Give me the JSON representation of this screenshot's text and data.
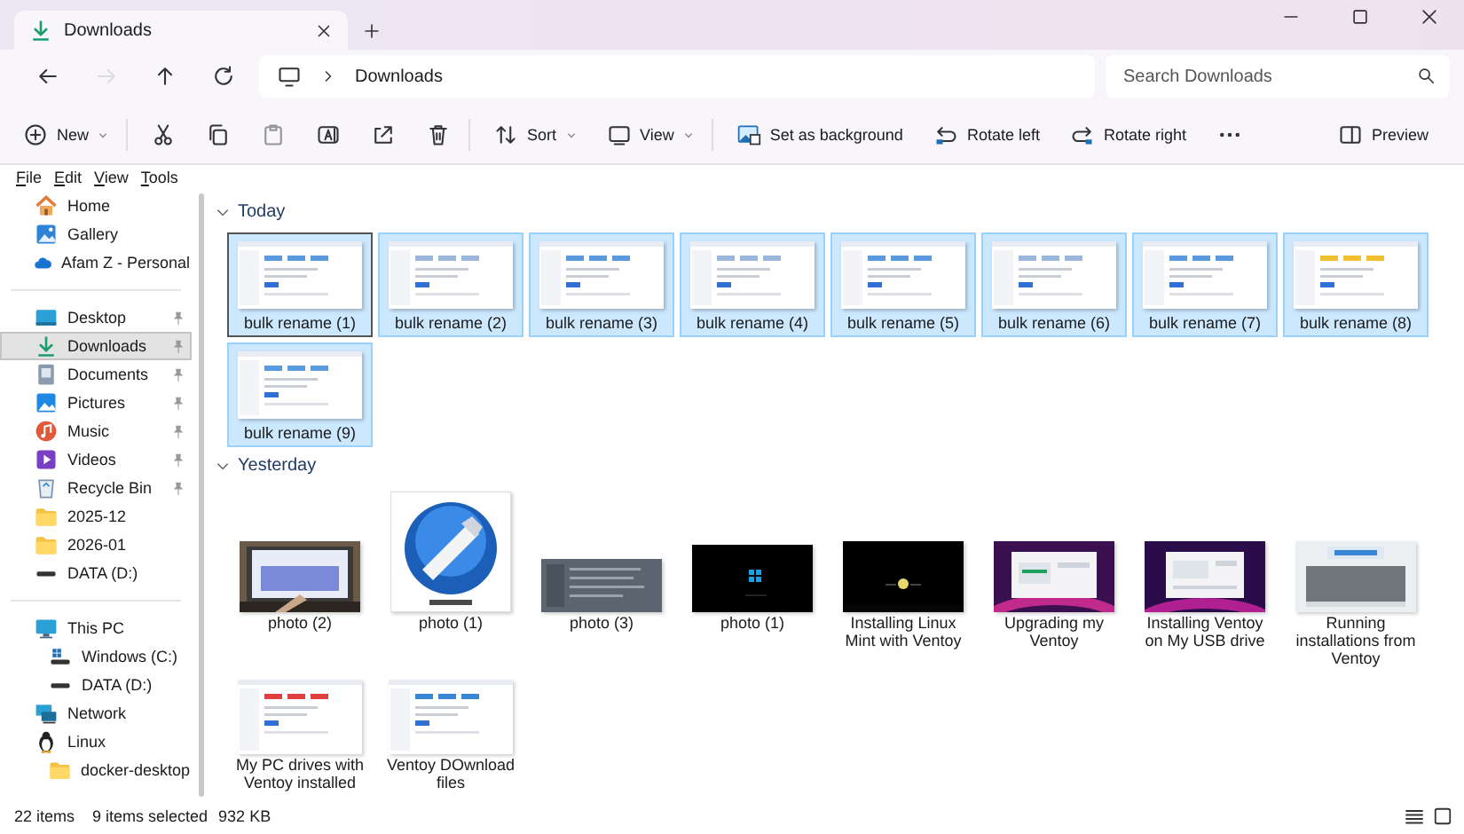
{
  "window": {
    "tab_title": "Downloads"
  },
  "address": {
    "path": "Downloads",
    "search_placeholder": "Search Downloads",
    "forward_disabled": true
  },
  "toolbar": {
    "items": [
      {
        "kind": "new",
        "label": "New",
        "dropdown": true,
        "disabled": false
      },
      {
        "kind": "cut",
        "disabled": false
      },
      {
        "kind": "copy",
        "disabled": false
      },
      {
        "kind": "paste",
        "disabled": true
      },
      {
        "kind": "rename",
        "disabled": false
      },
      {
        "kind": "share",
        "disabled": false
      },
      {
        "kind": "delete",
        "disabled": false
      },
      {
        "kind": "sort",
        "label": "Sort",
        "dropdown": true,
        "disabled": false
      },
      {
        "kind": "view",
        "label": "View",
        "dropdown": true,
        "disabled": false
      },
      {
        "kind": "background",
        "label": "Set as background",
        "disabled": false
      },
      {
        "kind": "rotate-left",
        "label": "Rotate left",
        "disabled": false
      },
      {
        "kind": "rotate-right",
        "label": "Rotate right",
        "disabled": false
      },
      {
        "kind": "more",
        "disabled": false
      }
    ],
    "preview": {
      "label": "Preview"
    }
  },
  "menu": [
    "File",
    "Edit",
    "View",
    "Tools"
  ],
  "sidebar": {
    "sections": [
      {
        "items": [
          {
            "label": "Home",
            "pinned": false,
            "selected": false
          },
          {
            "label": "Gallery",
            "pinned": false,
            "selected": false
          },
          {
            "label": "Afam Z - Personal",
            "pinned": false,
            "selected": false
          }
        ]
      },
      {
        "items": [
          {
            "label": "Desktop",
            "pinned": true,
            "selected": false
          },
          {
            "label": "Downloads",
            "pinned": true,
            "selected": true
          },
          {
            "label": "Documents",
            "pinned": true,
            "selected": false
          },
          {
            "label": "Pictures",
            "pinned": true,
            "selected": false
          },
          {
            "label": "Music",
            "pinned": true,
            "selected": false
          },
          {
            "label": "Videos",
            "pinned": true,
            "selected": false
          },
          {
            "label": "Recycle Bin",
            "pinned": true,
            "selected": false
          },
          {
            "label": "2025-12",
            "pinned": false,
            "selected": false
          },
          {
            "label": "2026-01",
            "pinned": false,
            "selected": false
          },
          {
            "label": "DATA (D:)",
            "pinned": false,
            "selected": false
          }
        ]
      },
      {
        "items": [
          {
            "label": "This PC",
            "pinned": false,
            "selected": false,
            "children": [
              {
                "label": "Windows (C:)",
                "pinned": false,
                "selected": false
              },
              {
                "label": "DATA (D:)",
                "pinned": false,
                "selected": false
              }
            ]
          },
          {
            "label": "Network",
            "pinned": false,
            "selected": false
          },
          {
            "label": "Linux",
            "pinned": false,
            "selected": false,
            "children": [
              {
                "label": "docker-desktop",
                "pinned": false,
                "selected": false
              }
            ]
          }
        ]
      }
    ]
  },
  "content": {
    "groups": [
      {
        "title": "Today",
        "expanded": true,
        "items": [
          {
            "name": "bulk rename (1)",
            "kind": "picture",
            "selected": true
          },
          {
            "name": "bulk rename (2)",
            "kind": "picture",
            "selected": true
          },
          {
            "name": "bulk rename (3)",
            "kind": "picture",
            "selected": true
          },
          {
            "name": "bulk rename (4)",
            "kind": "picture",
            "selected": true
          },
          {
            "name": "bulk rename (5)",
            "kind": "picture",
            "selected": true
          },
          {
            "name": "bulk rename (6)",
            "kind": "picture",
            "selected": true
          },
          {
            "name": "bulk rename (7)",
            "kind": "picture",
            "selected": true
          },
          {
            "name": "bulk rename (8)",
            "kind": "picture",
            "selected": true
          },
          {
            "name": "bulk rename (9)",
            "kind": "picture",
            "selected": true
          }
        ]
      },
      {
        "title": "Yesterday",
        "expanded": true,
        "items": [
          {
            "name": "photo (2)",
            "kind": "picture",
            "selected": false
          },
          {
            "name": "photo (1)",
            "kind": "picture",
            "selected": false
          },
          {
            "name": "photo (3)",
            "kind": "picture",
            "selected": false
          },
          {
            "name": "photo (1)",
            "kind": "picture",
            "selected": false
          },
          {
            "name": "Installing Linux Mint with Ventoy",
            "kind": "picture",
            "selected": false
          },
          {
            "name": "Upgrading my Ventoy",
            "kind": "picture",
            "selected": false
          },
          {
            "name": "Installing Ventoy on My USB drive",
            "kind": "picture",
            "selected": false
          },
          {
            "name": "Running installations from Ventoy",
            "kind": "picture",
            "selected": false
          },
          {
            "name": "My PC drives with Ventoy installed",
            "kind": "picture",
            "selected": false
          },
          {
            "name": "Ventoy DOwnload files",
            "kind": "picture",
            "selected": false
          }
        ]
      }
    ]
  },
  "status_bar": {
    "count": "22 items",
    "selection": "9 items selected",
    "size": "932 KB"
  }
}
